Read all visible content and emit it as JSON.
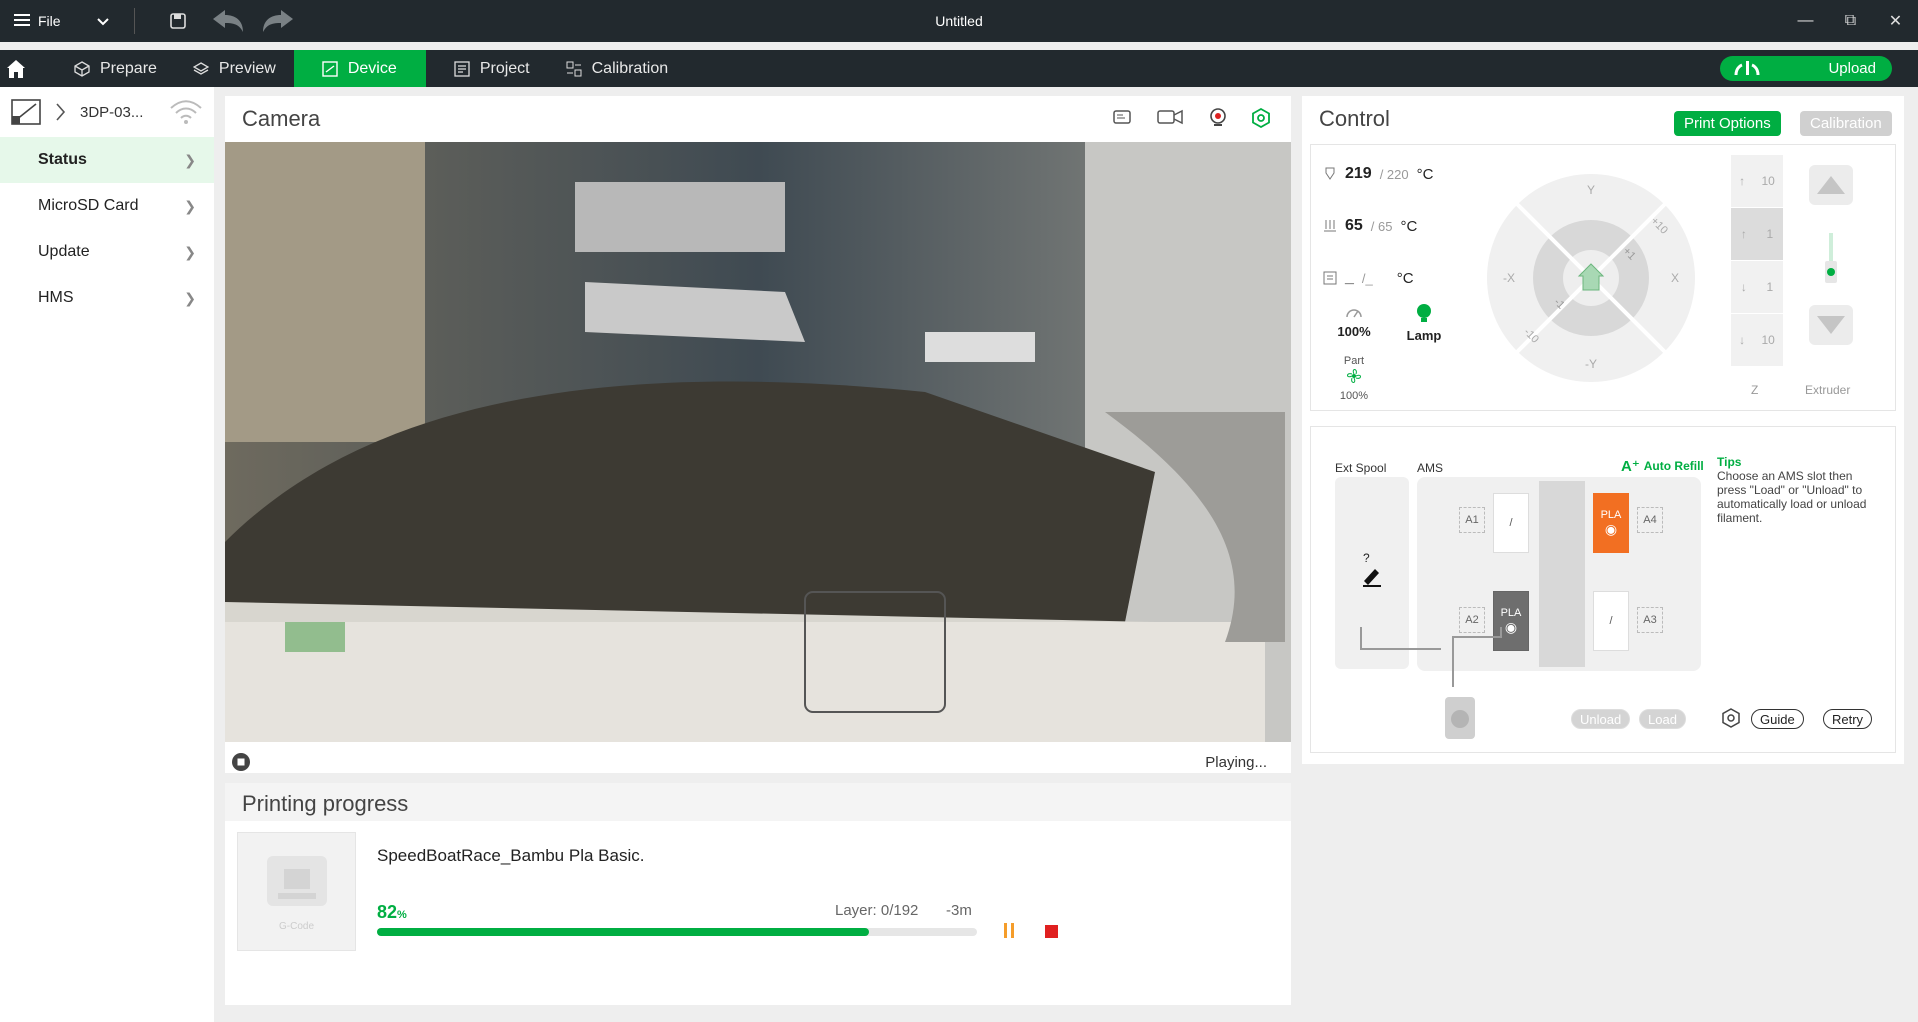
{
  "titlebar": {
    "file_label": "File",
    "title": "Untitled"
  },
  "tabs": [
    {
      "label": "Prepare",
      "icon": "cube-icon"
    },
    {
      "label": "Preview",
      "icon": "layers-icon"
    },
    {
      "label": "Device",
      "icon": "device-icon",
      "active": true
    },
    {
      "label": "Project",
      "icon": "project-icon"
    },
    {
      "label": "Calibration",
      "icon": "calibration-icon"
    }
  ],
  "upload_label": "Upload",
  "device": {
    "name": "3DP-03..."
  },
  "sidebar": {
    "items": [
      {
        "label": "Status",
        "active": true
      },
      {
        "label": "MicroSD Card"
      },
      {
        "label": "Update"
      },
      {
        "label": "HMS"
      }
    ]
  },
  "camera": {
    "title": "Camera",
    "status": "Playing..."
  },
  "progress": {
    "title": "Printing progress",
    "thumb_label": "G-Code",
    "file_name": "SpeedBoatRace_Bambu Pla Basic.",
    "percent": "82",
    "percent_unit": "%",
    "percent_value": 82,
    "layer": "Layer: 0/192",
    "time": "-3m"
  },
  "control": {
    "title": "Control",
    "print_options_label": "Print Options",
    "calibration_label": "Calibration",
    "nozzle": {
      "current": "219",
      "target": "/ 220",
      "unit": "°C"
    },
    "bed": {
      "current": "65",
      "target": "/ 65",
      "unit": "°C"
    },
    "chamber": {
      "current": "_",
      "target": "/_",
      "unit": "°C"
    },
    "speed": {
      "value": "100%"
    },
    "lamp": {
      "label": "Lamp"
    },
    "part_fan": {
      "label": "Part",
      "value": "100%"
    },
    "jog": {
      "y": "Y",
      "neg_y": "-Y",
      "x": "X",
      "neg_x": "-X",
      "p10": "+10",
      "p1": "+1",
      "n1": "-1",
      "n10": "-10"
    },
    "z": {
      "label": "Z",
      "steps": [
        "10",
        "1",
        "1",
        "10"
      ]
    },
    "extruder_label": "Extruder"
  },
  "ams": {
    "ext_spool_label": "Ext Spool",
    "ext_spool_value": "?",
    "ams_label": "AMS",
    "auto_refill_label": "Auto Refill",
    "tips_title": "Tips",
    "tips_text": "Choose an AMS slot then press \"Load\" or \"Unload\" to automatically load or unload filament.",
    "slots": [
      {
        "id": "A1",
        "value": "/"
      },
      {
        "id": "A2",
        "value": "PLA"
      },
      {
        "id": "A3",
        "value": "/"
      },
      {
        "id": "A4",
        "value": "PLA"
      }
    ],
    "unload_label": "Unload",
    "load_label": "Load",
    "guide_label": "Guide",
    "retry_label": "Retry"
  },
  "colors": {
    "accent": "#00ae42",
    "dark": "#22292e",
    "slot_orange": "#f26f22",
    "stop_red": "#e02020",
    "pause_orange": "#f59d2a"
  }
}
